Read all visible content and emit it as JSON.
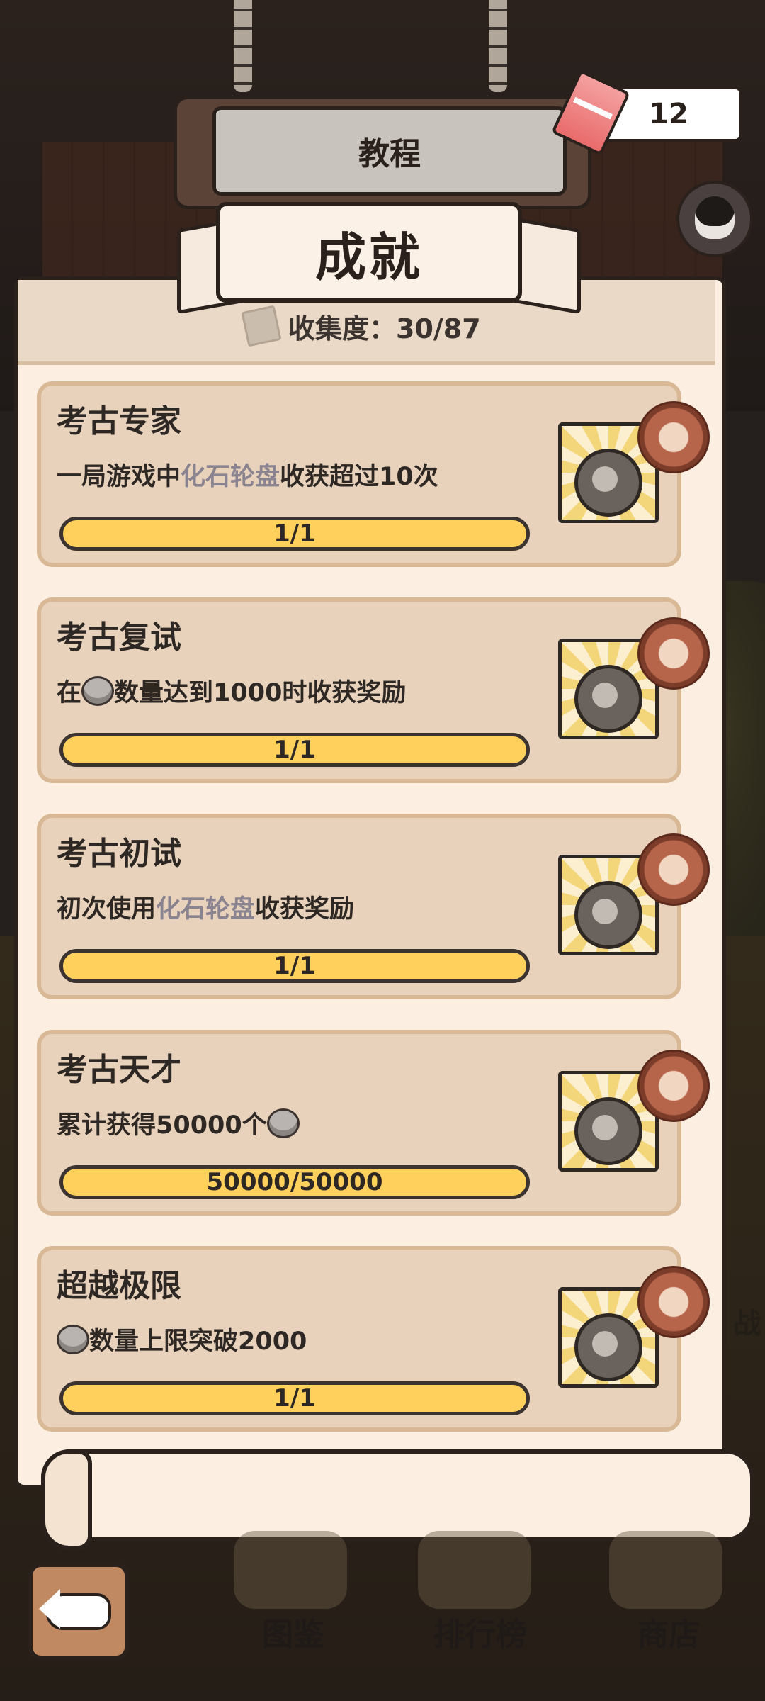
{
  "header": {
    "tutorial_label": "教程",
    "ticket_count": "12",
    "title": "成就",
    "collection_label": "收集度：30/87"
  },
  "achievements": [
    {
      "name": "考古专家",
      "desc_parts": [
        "一局游戏中",
        "化石轮盘",
        "收获超过10次"
      ],
      "progress": "1/1",
      "fill": 1.0
    },
    {
      "name": "考古复试",
      "desc_parts": [
        "在",
        "数量达到1000时收获奖励"
      ],
      "progress": "1/1",
      "fill": 1.0
    },
    {
      "name": "考古初试",
      "desc_parts": [
        "初次使用",
        "化石轮盘",
        "收获奖励"
      ],
      "progress": "1/1",
      "fill": 1.0
    },
    {
      "name": "考古天才",
      "desc_parts": [
        "累计获得50000个"
      ],
      "progress": "50000/50000",
      "fill": 1.0
    },
    {
      "name": "超越极限",
      "desc_parts": [
        "数量上限突破2000"
      ],
      "progress": "1/1",
      "fill": 1.0
    }
  ],
  "bottom_nav": {
    "items": [
      "图鉴",
      "排行榜",
      "商店"
    ]
  },
  "side_text": "战",
  "icons": {
    "ticket": "ticket-icon",
    "book": "book-icon",
    "coin": "fossil-coin-icon",
    "badge_reward": "paw-icon",
    "back": "back-arrow-icon"
  },
  "colors": {
    "bar_fill": "#ffd05c",
    "card_bg": "#e8d2bb",
    "panel_bg": "#fcefe1",
    "highlight_text": "#8a8390"
  }
}
